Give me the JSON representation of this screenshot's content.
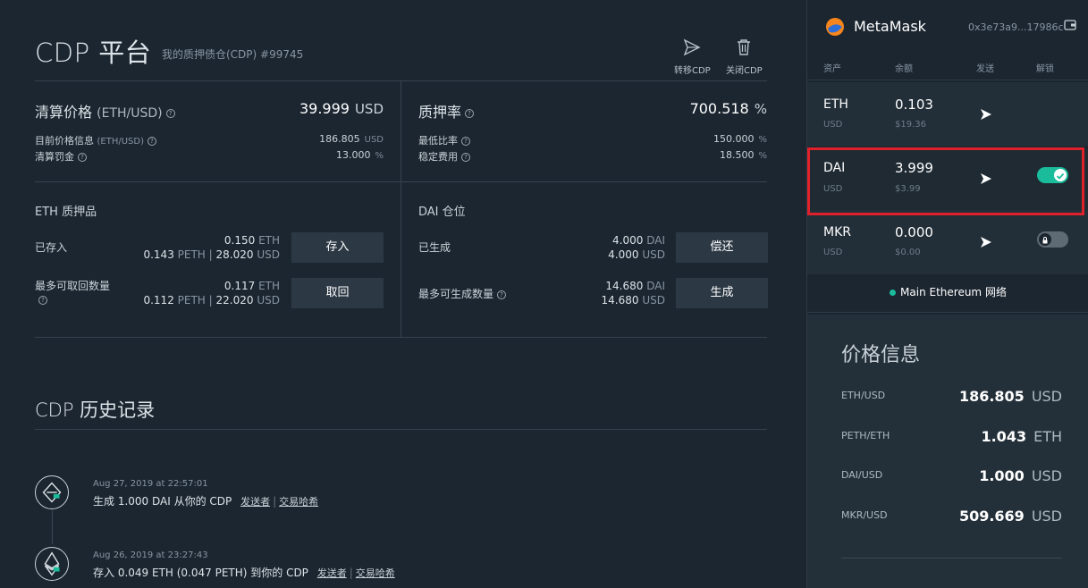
{
  "header": {
    "title": "CDP 平台",
    "subtitle": "我的质押债仓(CDP) #99745",
    "transfer_label": "转移CDP",
    "close_label": "关闭CDP"
  },
  "liquidation": {
    "label": "清算价格",
    "label_en": "(ETH/USD)",
    "value": "39.999",
    "unit": "USD",
    "current_price_label": "目前价格信息",
    "current_price_label_en": "(ETH/USD)",
    "current_price_value": "186.805",
    "current_price_unit": "USD",
    "penalty_label": "清算罚金",
    "penalty_value": "13.000",
    "penalty_unit": "%"
  },
  "collateralization": {
    "label": "质押率",
    "value": "700.518",
    "unit": "%",
    "min_ratio_label": "最低比率",
    "min_ratio_value": "150.000",
    "min_ratio_unit": "%",
    "stability_fee_label": "稳定费用",
    "stability_fee_value": "18.500",
    "stability_fee_unit": "%"
  },
  "eth_collateral": {
    "title": "ETH 质押品",
    "deposited_label": "已存入",
    "deposited_eth": "0.150",
    "deposited_eth_unit": "ETH",
    "deposited_peth": "0.143",
    "deposited_peth_unit": "PETH",
    "deposited_usd": "28.020",
    "deposited_usd_unit": "USD",
    "deposit_button": "存入",
    "max_withdraw_label": "最多可取回数量",
    "max_withdraw_eth": "0.117",
    "max_withdraw_eth_unit": "ETH",
    "max_withdraw_peth": "0.112",
    "max_withdraw_peth_unit": "PETH",
    "max_withdraw_usd": "22.020",
    "max_withdraw_usd_unit": "USD",
    "withdraw_button": "取回"
  },
  "dai_position": {
    "title": "DAI 仓位",
    "generated_label": "已生成",
    "generated_dai": "4.000",
    "generated_dai_unit": "DAI",
    "generated_usd": "4.000",
    "generated_usd_unit": "USD",
    "payback_button": "偿还",
    "max_generate_label": "最多可生成数量",
    "max_generate_dai": "14.680",
    "max_generate_dai_unit": "DAI",
    "max_generate_usd": "14.680",
    "max_generate_usd_unit": "USD",
    "generate_button": "生成"
  },
  "history": {
    "title": "CDP 历史记录",
    "sender_link": "发送者",
    "tx_link": "交易哈希",
    "separator": "|",
    "items": [
      {
        "date": "Aug 27, 2019 at 22:57:01",
        "text": "生成 1.000 DAI 从你的 CDP"
      },
      {
        "date": "Aug 26, 2019 at 23:27:43",
        "text": "存入 0.049 ETH (0.047 PETH) 到你的 CDP"
      }
    ]
  },
  "metamask": {
    "title": "MetaMask",
    "address": "0x3e73a9...17986c",
    "columns": {
      "asset": "资产",
      "balance": "余额",
      "send": "发送",
      "unlock": "解锁"
    },
    "assets": [
      {
        "name": "ETH",
        "sub": "USD",
        "balance": "0.103",
        "usd": "$19.36"
      },
      {
        "name": "DAI",
        "sub": "USD",
        "balance": "3.999",
        "usd": "$3.99",
        "unlocked": true
      },
      {
        "name": "MKR",
        "sub": "USD",
        "balance": "0.000",
        "usd": "$0.00",
        "unlocked": false
      }
    ],
    "network": "Main Ethereum",
    "network_suffix": "网络"
  },
  "price_info": {
    "title": "价格信息",
    "rows": [
      {
        "pair": "ETH/USD",
        "value": "186.805",
        "unit": "USD"
      },
      {
        "pair": "PETH/ETH",
        "value": "1.043",
        "unit": "ETH"
      },
      {
        "pair": "DAI/USD",
        "value": "1.000",
        "unit": "USD"
      },
      {
        "pair": "MKR/USD",
        "value": "509.669",
        "unit": "USD"
      }
    ]
  },
  "colors": {
    "background": "#1c2630",
    "accent_green": "#1abc9c",
    "highlight_red": "#e0202a"
  }
}
